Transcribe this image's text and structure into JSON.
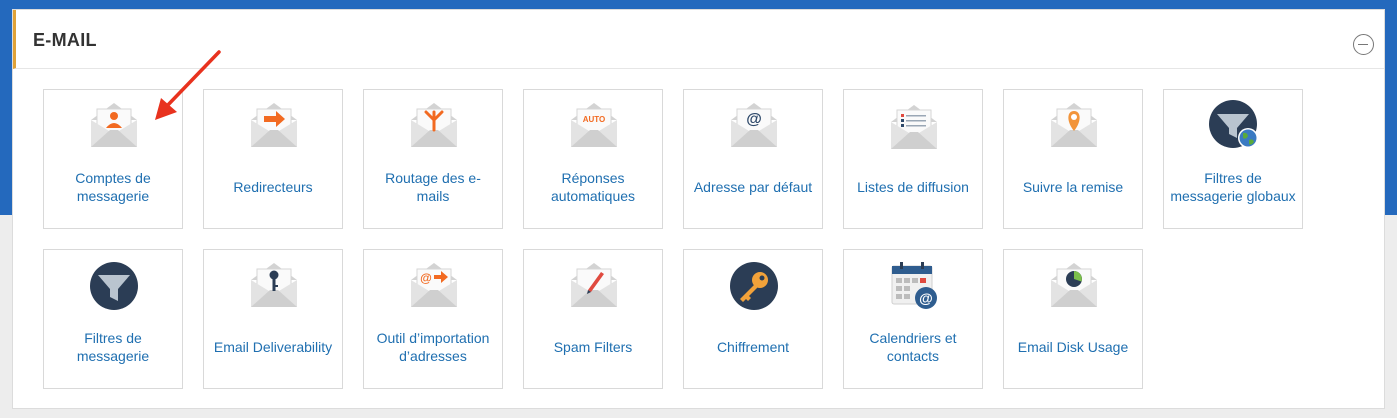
{
  "section": {
    "title": "E-MAIL"
  },
  "colors": {
    "link": "#1f6fb0",
    "accent_orange": "#f26a21",
    "header_band": "#2469bd",
    "annotation_arrow": "#e8321e"
  },
  "tiles": [
    {
      "label": "Comptes de messagerie",
      "icon": "email-accounts-icon"
    },
    {
      "label": "Redirecteurs",
      "icon": "forwarders-icon"
    },
    {
      "label": "Routage des e-mails",
      "icon": "email-routing-icon"
    },
    {
      "label": "Réponses automatiques",
      "icon": "autoresponders-icon",
      "badge": "AUTO"
    },
    {
      "label": "Adresse par défaut",
      "icon": "default-address-icon"
    },
    {
      "label": "Listes de diffusion",
      "icon": "mailing-lists-icon"
    },
    {
      "label": "Suivre la remise",
      "icon": "track-delivery-icon"
    },
    {
      "label": "Filtres de messagerie globaux",
      "icon": "global-filters-icon"
    },
    {
      "label": "Filtres de messagerie",
      "icon": "email-filters-icon"
    },
    {
      "label": "Email Deliverability",
      "icon": "email-deliverability-icon"
    },
    {
      "label": "Outil d’importation d’adresses",
      "icon": "address-importer-icon"
    },
    {
      "label": "Spam Filters",
      "icon": "spam-filters-icon"
    },
    {
      "label": "Chiffrement",
      "icon": "encryption-icon"
    },
    {
      "label": "Calendriers et contacts",
      "icon": "calendars-contacts-icon"
    },
    {
      "label": "Email Disk Usage",
      "icon": "email-disk-usage-icon"
    }
  ]
}
